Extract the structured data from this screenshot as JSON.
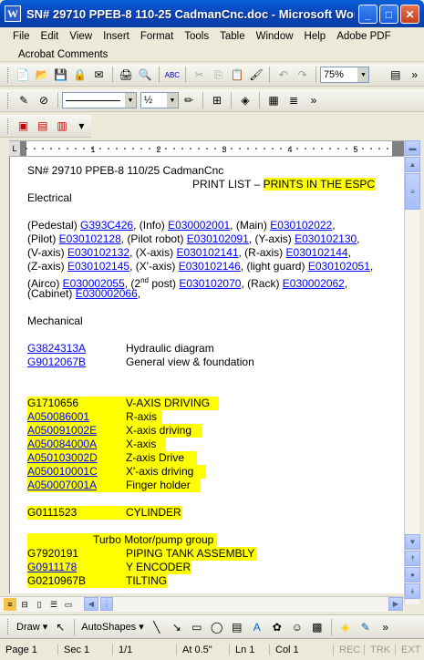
{
  "window": {
    "title": "SN# 29710 PPEB-8 110-25 CadmanCnc.doc - Microsoft Word"
  },
  "menu": {
    "items": [
      "File",
      "Edit",
      "View",
      "Insert",
      "Format",
      "Tools",
      "Table",
      "Window",
      "Help",
      "Adobe PDF"
    ],
    "second_row": "Acrobat Comments"
  },
  "toolbar": {
    "zoom": "75%",
    "line_weight": "½"
  },
  "document": {
    "line1": "SN# 29710    PPEB-8 110/25 CadmanCnc",
    "print_list_prefix": "PRINT LIST – ",
    "print_list_highlight": "PRINTS IN THE ESPC",
    "electrical_heading": "Electrical",
    "elec": [
      [
        {
          "t": "(Pedestal) "
        },
        {
          "l": "G393C426"
        },
        {
          "t": ", (Info) "
        },
        {
          "l": "E030002001"
        },
        {
          "t": ", (Main) "
        },
        {
          "l": "E030102022"
        },
        {
          "t": ","
        }
      ],
      [
        {
          "t": "(Pilot) "
        },
        {
          "l": "E030102128"
        },
        {
          "t": ", (Pilot robot) "
        },
        {
          "l": "E030102091"
        },
        {
          "t": ", (Y-axis) "
        },
        {
          "l": "E030102130"
        },
        {
          "t": ","
        }
      ],
      [
        {
          "t": "(V-axis) "
        },
        {
          "l": "E030102132"
        },
        {
          "t": ", (X-axis) "
        },
        {
          "l": "E030102141"
        },
        {
          "t": ", (R-axis) "
        },
        {
          "l": "E030102144"
        },
        {
          "t": ","
        }
      ],
      [
        {
          "t": "(Z-axis) "
        },
        {
          "l": "E030102145"
        },
        {
          "t": ", (X'-axis) "
        },
        {
          "l": "E030102146"
        },
        {
          "t": ", (light guard) "
        },
        {
          "l": "E030102051"
        },
        {
          "t": ","
        }
      ],
      [
        {
          "t": "(Airco) "
        },
        {
          "l": "E030002055"
        },
        {
          "t": ", (2"
        },
        {
          "sup": "nd"
        },
        {
          "t": " post) "
        },
        {
          "l": "E030102070"
        },
        {
          "t": ", (Rack) "
        },
        {
          "l": "E030002062"
        },
        {
          "t": ","
        }
      ],
      [
        {
          "t": "(Cabinet) "
        },
        {
          "l": "E030002066"
        },
        {
          "t": ","
        }
      ]
    ],
    "mechanical_heading": "Mechanical",
    "mech": [
      {
        "part": "G3824313A",
        "desc": "Hydraulic diagram"
      },
      {
        "part": "G9012067B",
        "desc": "General view & foundation"
      }
    ],
    "vaxis": [
      {
        "part": "G1710656",
        "desc": "V-AXIS DRIVING",
        "link": false
      },
      {
        "part": "A050086001",
        "desc": "R-axis",
        "link": true
      },
      {
        "part": "A050091002E",
        "desc": "X-axis driving",
        "link": true
      },
      {
        "part": "A050084000A",
        "desc": "X-axis",
        "link": true
      },
      {
        "part": "A050103002D",
        "desc": "Z-axis Drive",
        "link": true
      },
      {
        "part": "A050010001C",
        "desc": "X'-axis driving",
        "link": true
      },
      {
        "part": "A050007001A",
        "desc": "Finger holder",
        "link": true
      }
    ],
    "cylinder": {
      "part": "G0111523",
      "desc": "CYLINDER"
    },
    "turbo_heading": "Turbo Motor/pump group",
    "turbo": [
      {
        "part": "G7920191",
        "desc": "PIPING TANK ASSEMBLY",
        "link": false
      },
      {
        "part": "G0911178",
        "desc": "Y ENCODER",
        "link": true
      },
      {
        "part": "G0210967B",
        "desc": "TILTING",
        "link": false
      }
    ]
  },
  "drawbar": {
    "draw": "Draw",
    "autoshapes": "AutoShapes"
  },
  "status": {
    "page": "Page 1",
    "sec": "Sec 1",
    "pages": "1/1",
    "at": "At 0.5\"",
    "ln": "Ln 1",
    "col": "Col 1",
    "rec": "REC",
    "trk": "TRK",
    "ext": "EXT"
  }
}
